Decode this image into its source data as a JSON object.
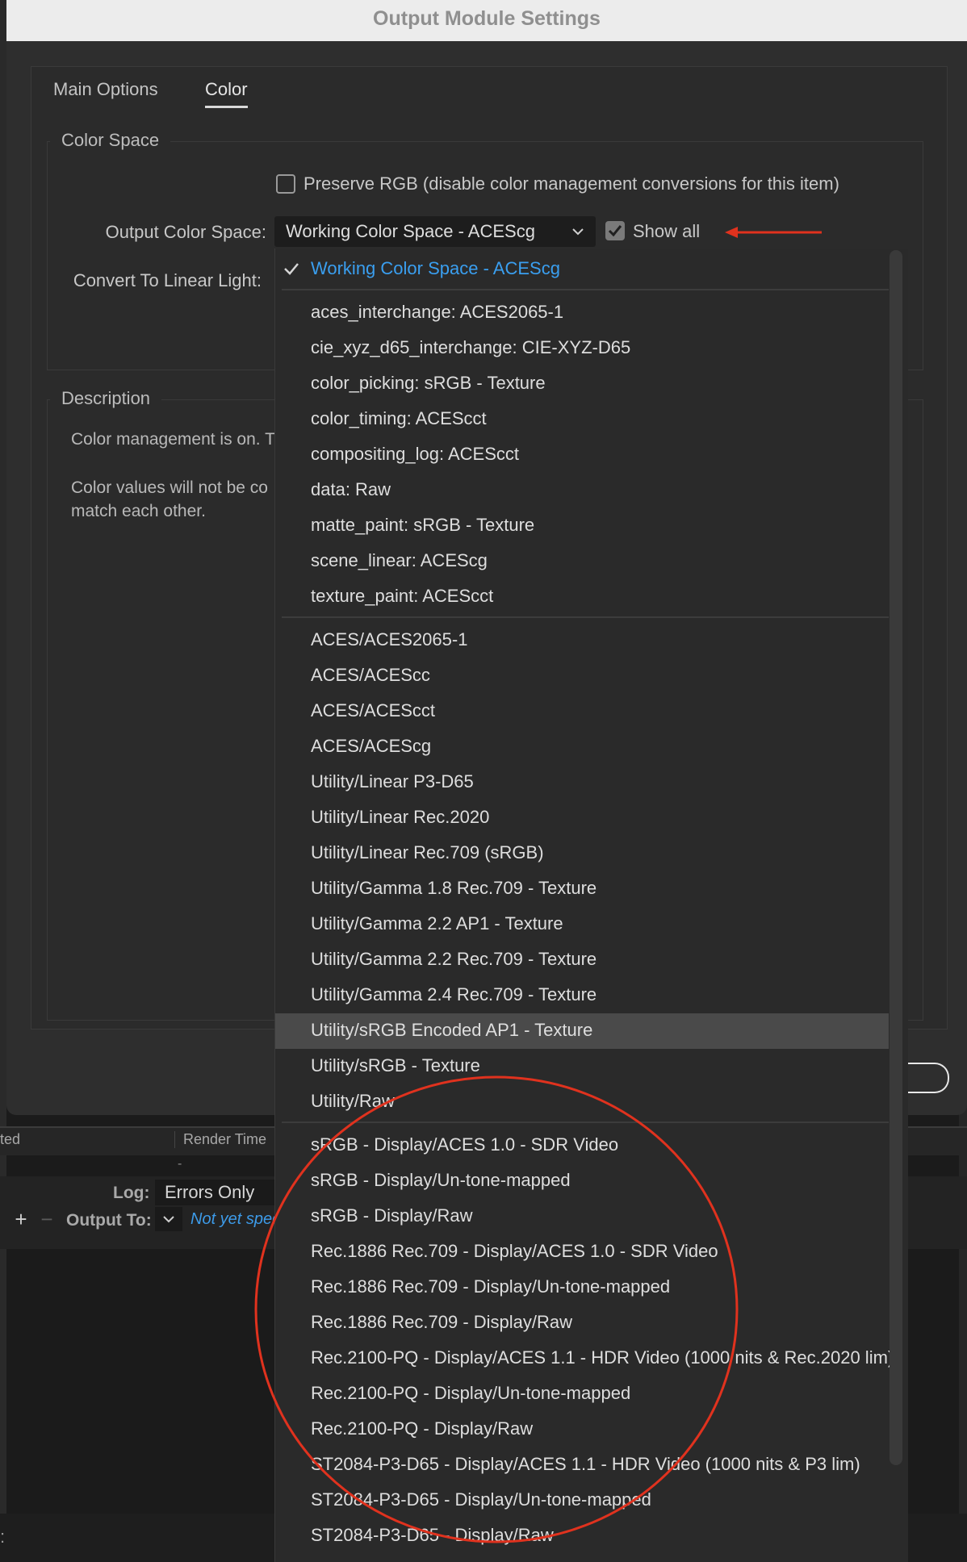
{
  "dialog": {
    "title": "Output Module Settings",
    "tabs": [
      "Main Options",
      "Color"
    ],
    "active_tab": "Color"
  },
  "color_space": {
    "legend": "Color Space",
    "preserve_rgb_label": "Preserve RGB (disable color management conversions for this item)",
    "preserve_rgb_checked": false,
    "output_label": "Output Color Space:",
    "output_value": "Working Color Space - ACEScg",
    "show_all_label": "Show all",
    "show_all_checked": true,
    "linear_label": "Convert To Linear Light:"
  },
  "description": {
    "legend": "Description",
    "line1": "Color management is on. T",
    "line2": "Color values will not be co match each other."
  },
  "dropdown": {
    "groups": [
      {
        "items": [
          "Working Color Space - ACEScg"
        ]
      },
      {
        "items": [
          "aces_interchange: ACES2065-1",
          "cie_xyz_d65_interchange: CIE-XYZ-D65",
          "color_picking: sRGB - Texture",
          "color_timing: ACEScct",
          "compositing_log: ACEScct",
          "data: Raw",
          "matte_paint: sRGB - Texture",
          "scene_linear: ACEScg",
          "texture_paint: ACEScct"
        ]
      },
      {
        "items": [
          "ACES/ACES2065-1",
          "ACES/ACEScc",
          "ACES/ACEScct",
          "ACES/ACEScg",
          "Utility/Linear P3-D65",
          "Utility/Linear Rec.2020",
          "Utility/Linear Rec.709 (sRGB)",
          "Utility/Gamma 1.8 Rec.709 - Texture",
          "Utility/Gamma 2.2 AP1 - Texture",
          "Utility/Gamma 2.2 Rec.709 - Texture",
          "Utility/Gamma 2.4 Rec.709 - Texture",
          "Utility/sRGB Encoded AP1 - Texture",
          "Utility/sRGB - Texture",
          "Utility/Raw"
        ]
      },
      {
        "items": [
          "sRGB - Display/ACES 1.0 - SDR Video",
          "sRGB - Display/Un-tone-mapped",
          "sRGB - Display/Raw",
          "Rec.1886 Rec.709 - Display/ACES 1.0 - SDR Video",
          "Rec.1886 Rec.709 - Display/Un-tone-mapped",
          "Rec.1886 Rec.709 - Display/Raw",
          "Rec.2100-PQ - Display/ACES 1.1 - HDR Video (1000 nits & Rec.2020 lim)",
          "Rec.2100-PQ - Display/Un-tone-mapped",
          "Rec.2100-PQ - Display/Raw",
          "ST2084-P3-D65 - Display/ACES 1.1 - HDR Video (1000 nits & P3 lim)",
          "ST2084-P3-D65 - Display/Un-tone-mapped",
          "ST2084-P3-D65 - Display/Raw"
        ]
      }
    ],
    "selected": "Working Color Space - ACEScg",
    "highlighted": "Utility/sRGB Encoded AP1 - Texture",
    "selected_color": "#3a9ff0"
  },
  "render_queue": {
    "col1": "ted",
    "col2": "Render Time",
    "dash": "-",
    "log_label": "Log:",
    "log_value": "Errors Only",
    "output_to_label": "Output To:",
    "output_to_value": "Not yet spec",
    "add_icon": "plus-icon",
    "remove_icon": "minus-icon",
    "colon": ":"
  },
  "annotations": {
    "color": "#e0321e",
    "arrow_target": "Show all",
    "circled_group": "display transforms"
  }
}
